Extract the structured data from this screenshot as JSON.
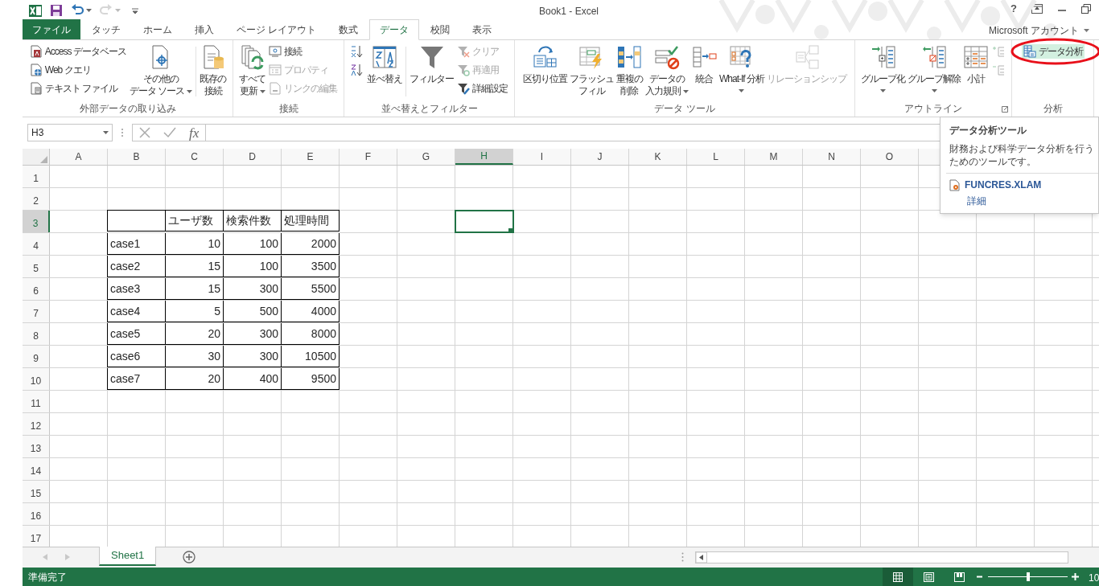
{
  "window": {
    "title": "Book1 - Excel",
    "help": "?"
  },
  "quick_access": [
    {
      "kind": "logo",
      "disabled": false
    },
    {
      "kind": "save",
      "disabled": false
    },
    {
      "kind": "undo",
      "disabled": false
    },
    {
      "kind": "redo",
      "disabled": true
    },
    {
      "kind": "customize",
      "disabled": false
    }
  ],
  "tabs": [
    {
      "label": "ファイル",
      "kind": "file",
      "selected": false
    },
    {
      "label": "タッチ",
      "kind": "tab",
      "selected": false
    },
    {
      "label": "ホーム",
      "kind": "tab",
      "selected": false
    },
    {
      "label": "挿入",
      "kind": "tab",
      "selected": false
    },
    {
      "label": "ページ レイアウト",
      "kind": "tab",
      "selected": false
    },
    {
      "label": "数式",
      "kind": "tab",
      "selected": false
    },
    {
      "label": "データ",
      "kind": "tab",
      "selected": true
    },
    {
      "label": "校閲",
      "kind": "tab",
      "selected": false
    },
    {
      "label": "表示",
      "kind": "tab",
      "selected": false
    }
  ],
  "account": "Microsoft アカウント",
  "ribbon": {
    "groups": [
      {
        "label": "外部データの取り込み",
        "launcher": false,
        "items": [
          {
            "kind": "stack",
            "items": [
              {
                "label": "Access データベース",
                "disabled": false
              },
              {
                "label": "Web クエリ",
                "disabled": false
              },
              {
                "label": "テキスト ファイル",
                "disabled": false
              }
            ]
          },
          {
            "kind": "large",
            "lines": [
              "その他の",
              "データ ソース"
            ],
            "dropdown": true,
            "disabled": false
          },
          {
            "kind": "separator"
          },
          {
            "kind": "large",
            "lines": [
              "既存の",
              "接続"
            ],
            "dropdown": false,
            "disabled": false
          }
        ]
      },
      {
        "label": "接続",
        "launcher": false,
        "items": [
          {
            "kind": "large",
            "lines": [
              "すべて",
              "更新"
            ],
            "dropdown": true,
            "disabled": false
          },
          {
            "kind": "stack",
            "items": [
              {
                "label": "接続",
                "disabled": false
              },
              {
                "label": "プロパティ",
                "disabled": true
              },
              {
                "label": "リンクの編集",
                "disabled": true
              }
            ]
          }
        ]
      },
      {
        "label": "並べ替えとフィルター",
        "launcher": false,
        "items": [
          {
            "kind": "stack",
            "items": [
              {
                "disabled": false
              },
              {
                "disabled": false
              }
            ]
          },
          {
            "kind": "large",
            "lines": [
              "並べ替え"
            ],
            "dropdown": false,
            "disabled": false
          },
          {
            "kind": "separator"
          },
          {
            "kind": "large",
            "lines": [
              "フィルター"
            ],
            "dropdown": false,
            "disabled": false
          },
          {
            "kind": "stack",
            "items": [
              {
                "label": "クリア",
                "disabled": true
              },
              {
                "label": "再適用",
                "disabled": true
              },
              {
                "label": "詳細設定",
                "disabled": false
              }
            ]
          }
        ]
      },
      {
        "label": "データ ツール",
        "launcher": false,
        "items": [
          {
            "kind": "large",
            "lines": [
              "区切り位置"
            ],
            "dropdown": false,
            "disabled": false
          },
          {
            "kind": "large",
            "lines": [
              "フラッシュ",
              "フィル"
            ],
            "dropdown": false,
            "disabled": false
          },
          {
            "kind": "large",
            "lines": [
              "重複の",
              "削除"
            ],
            "dropdown": false,
            "disabled": false
          },
          {
            "kind": "large",
            "lines": [
              "データの",
              "入力規則"
            ],
            "dropdown": true,
            "disabled": false
          },
          {
            "kind": "large",
            "lines": [
              "統合"
            ],
            "dropdown": false,
            "disabled": false
          },
          {
            "kind": "large",
            "lines": [
              "What-If 分析"
            ],
            "dropdown": true,
            "disabled": false
          },
          {
            "kind": "large",
            "lines": [
              "リレーションシップ"
            ],
            "dropdown": false,
            "disabled": true
          }
        ]
      },
      {
        "label": "アウトライン",
        "launcher": true,
        "items": [
          {
            "kind": "large",
            "lines": [
              "グループ化"
            ],
            "dropdown": true,
            "disabled": false
          },
          {
            "kind": "large",
            "lines": [
              "グループ解除"
            ],
            "dropdown": true,
            "disabled": false
          },
          {
            "kind": "large",
            "lines": [
              "小計"
            ],
            "dropdown": false,
            "disabled": false
          },
          {
            "kind": "stack",
            "items": [
              {
                "disabled": true
              },
              {
                "disabled": true
              }
            ]
          }
        ]
      },
      {
        "label": "分析",
        "launcher": false,
        "items": [
          {
            "kind": "stack",
            "items": [
              {
                "label": "データ分析",
                "disabled": false,
                "hovered": true,
                "circled": true
              }
            ]
          }
        ]
      }
    ]
  },
  "formula_bar": {
    "name_box": "H3",
    "function_label": "fx"
  },
  "sheet": {
    "columns": [
      {
        "label": "A",
        "selected": false
      },
      {
        "label": "B",
        "selected": false
      },
      {
        "label": "C",
        "selected": false
      },
      {
        "label": "D",
        "selected": false
      },
      {
        "label": "E",
        "selected": false
      },
      {
        "label": "F",
        "selected": false
      },
      {
        "label": "G",
        "selected": false
      },
      {
        "label": "H",
        "selected": true
      },
      {
        "label": "I",
        "selected": false
      },
      {
        "label": "J",
        "selected": false
      },
      {
        "label": "K",
        "selected": false
      },
      {
        "label": "L",
        "selected": false
      },
      {
        "label": "M",
        "selected": false
      },
      {
        "label": "N",
        "selected": false
      },
      {
        "label": "O",
        "selected": false
      }
    ],
    "rows": [
      {
        "label": "1",
        "selected": false
      },
      {
        "label": "2",
        "selected": false
      },
      {
        "label": "3",
        "selected": true
      },
      {
        "label": "4",
        "selected": false
      },
      {
        "label": "5",
        "selected": false
      },
      {
        "label": "6",
        "selected": false
      },
      {
        "label": "7",
        "selected": false
      },
      {
        "label": "8",
        "selected": false
      },
      {
        "label": "9",
        "selected": false
      },
      {
        "label": "10",
        "selected": false
      },
      {
        "label": "11",
        "selected": false
      },
      {
        "label": "12",
        "selected": false
      },
      {
        "label": "13",
        "selected": false
      },
      {
        "label": "14",
        "selected": false
      },
      {
        "label": "15",
        "selected": false
      },
      {
        "label": "16",
        "selected": false
      },
      {
        "label": "17",
        "selected": false
      }
    ],
    "table": {
      "header": [
        "ユーザ数",
        "検索件数",
        "処理時間"
      ],
      "rows": [
        {
          "label": "case1",
          "values": [
            "10",
            "100",
            "2000"
          ]
        },
        {
          "label": "case2",
          "values": [
            "15",
            "100",
            "3500"
          ]
        },
        {
          "label": "case3",
          "values": [
            "15",
            "300",
            "5500"
          ]
        },
        {
          "label": "case4",
          "values": [
            "5",
            "500",
            "4000"
          ]
        },
        {
          "label": "case5",
          "values": [
            "20",
            "300",
            "8000"
          ]
        },
        {
          "label": "case6",
          "values": [
            "30",
            "300",
            "10500"
          ]
        },
        {
          "label": "case7",
          "values": [
            "20",
            "400",
            "9500"
          ]
        }
      ]
    }
  },
  "tooltip": {
    "title": "データ分析ツール",
    "description": "財務および科学データ分析を行うためのツールです。",
    "file": "FUNCRES.XLAM",
    "link": "詳細"
  },
  "sheet_tabs": [
    {
      "label": "Sheet1",
      "selected": true
    }
  ],
  "status_bar": {
    "text": "準備完了",
    "views": [
      {
        "kind": "normal",
        "selected": true
      },
      {
        "kind": "page_layout",
        "selected": false
      },
      {
        "kind": "page_break",
        "selected": false
      }
    ],
    "zoom": {
      "level": 0.5,
      "reading": "10"
    }
  }
}
